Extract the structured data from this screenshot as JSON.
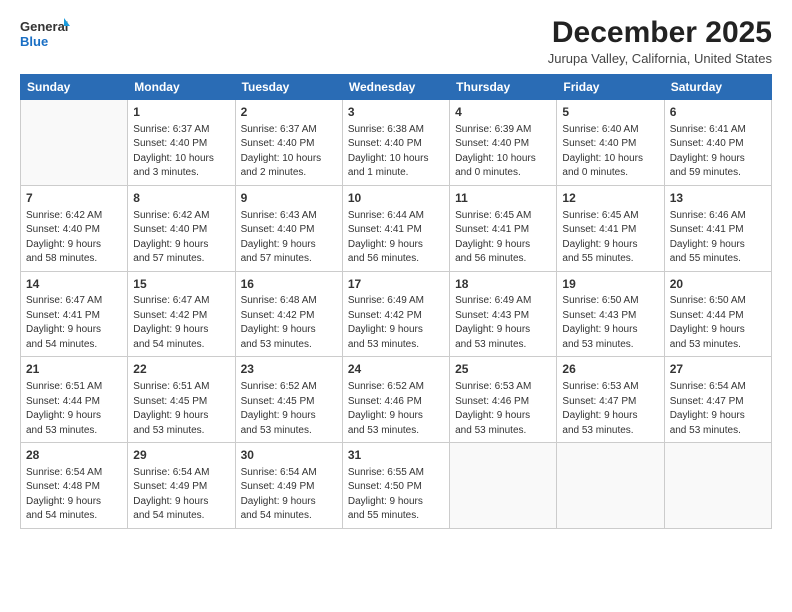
{
  "header": {
    "logo_line1": "General",
    "logo_line2": "Blue",
    "month": "December 2025",
    "location": "Jurupa Valley, California, United States"
  },
  "days_of_week": [
    "Sunday",
    "Monday",
    "Tuesday",
    "Wednesday",
    "Thursday",
    "Friday",
    "Saturday"
  ],
  "weeks": [
    [
      {
        "day": "",
        "info": ""
      },
      {
        "day": "1",
        "info": "Sunrise: 6:37 AM\nSunset: 4:40 PM\nDaylight: 10 hours\nand 3 minutes."
      },
      {
        "day": "2",
        "info": "Sunrise: 6:37 AM\nSunset: 4:40 PM\nDaylight: 10 hours\nand 2 minutes."
      },
      {
        "day": "3",
        "info": "Sunrise: 6:38 AM\nSunset: 4:40 PM\nDaylight: 10 hours\nand 1 minute."
      },
      {
        "day": "4",
        "info": "Sunrise: 6:39 AM\nSunset: 4:40 PM\nDaylight: 10 hours\nand 0 minutes."
      },
      {
        "day": "5",
        "info": "Sunrise: 6:40 AM\nSunset: 4:40 PM\nDaylight: 10 hours\nand 0 minutes."
      },
      {
        "day": "6",
        "info": "Sunrise: 6:41 AM\nSunset: 4:40 PM\nDaylight: 9 hours\nand 59 minutes."
      }
    ],
    [
      {
        "day": "7",
        "info": "Sunrise: 6:42 AM\nSunset: 4:40 PM\nDaylight: 9 hours\nand 58 minutes."
      },
      {
        "day": "8",
        "info": "Sunrise: 6:42 AM\nSunset: 4:40 PM\nDaylight: 9 hours\nand 57 minutes."
      },
      {
        "day": "9",
        "info": "Sunrise: 6:43 AM\nSunset: 4:40 PM\nDaylight: 9 hours\nand 57 minutes."
      },
      {
        "day": "10",
        "info": "Sunrise: 6:44 AM\nSunset: 4:41 PM\nDaylight: 9 hours\nand 56 minutes."
      },
      {
        "day": "11",
        "info": "Sunrise: 6:45 AM\nSunset: 4:41 PM\nDaylight: 9 hours\nand 56 minutes."
      },
      {
        "day": "12",
        "info": "Sunrise: 6:45 AM\nSunset: 4:41 PM\nDaylight: 9 hours\nand 55 minutes."
      },
      {
        "day": "13",
        "info": "Sunrise: 6:46 AM\nSunset: 4:41 PM\nDaylight: 9 hours\nand 55 minutes."
      }
    ],
    [
      {
        "day": "14",
        "info": "Sunrise: 6:47 AM\nSunset: 4:41 PM\nDaylight: 9 hours\nand 54 minutes."
      },
      {
        "day": "15",
        "info": "Sunrise: 6:47 AM\nSunset: 4:42 PM\nDaylight: 9 hours\nand 54 minutes."
      },
      {
        "day": "16",
        "info": "Sunrise: 6:48 AM\nSunset: 4:42 PM\nDaylight: 9 hours\nand 53 minutes."
      },
      {
        "day": "17",
        "info": "Sunrise: 6:49 AM\nSunset: 4:42 PM\nDaylight: 9 hours\nand 53 minutes."
      },
      {
        "day": "18",
        "info": "Sunrise: 6:49 AM\nSunset: 4:43 PM\nDaylight: 9 hours\nand 53 minutes."
      },
      {
        "day": "19",
        "info": "Sunrise: 6:50 AM\nSunset: 4:43 PM\nDaylight: 9 hours\nand 53 minutes."
      },
      {
        "day": "20",
        "info": "Sunrise: 6:50 AM\nSunset: 4:44 PM\nDaylight: 9 hours\nand 53 minutes."
      }
    ],
    [
      {
        "day": "21",
        "info": "Sunrise: 6:51 AM\nSunset: 4:44 PM\nDaylight: 9 hours\nand 53 minutes."
      },
      {
        "day": "22",
        "info": "Sunrise: 6:51 AM\nSunset: 4:45 PM\nDaylight: 9 hours\nand 53 minutes."
      },
      {
        "day": "23",
        "info": "Sunrise: 6:52 AM\nSunset: 4:45 PM\nDaylight: 9 hours\nand 53 minutes."
      },
      {
        "day": "24",
        "info": "Sunrise: 6:52 AM\nSunset: 4:46 PM\nDaylight: 9 hours\nand 53 minutes."
      },
      {
        "day": "25",
        "info": "Sunrise: 6:53 AM\nSunset: 4:46 PM\nDaylight: 9 hours\nand 53 minutes."
      },
      {
        "day": "26",
        "info": "Sunrise: 6:53 AM\nSunset: 4:47 PM\nDaylight: 9 hours\nand 53 minutes."
      },
      {
        "day": "27",
        "info": "Sunrise: 6:54 AM\nSunset: 4:47 PM\nDaylight: 9 hours\nand 53 minutes."
      }
    ],
    [
      {
        "day": "28",
        "info": "Sunrise: 6:54 AM\nSunset: 4:48 PM\nDaylight: 9 hours\nand 54 minutes."
      },
      {
        "day": "29",
        "info": "Sunrise: 6:54 AM\nSunset: 4:49 PM\nDaylight: 9 hours\nand 54 minutes."
      },
      {
        "day": "30",
        "info": "Sunrise: 6:54 AM\nSunset: 4:49 PM\nDaylight: 9 hours\nand 54 minutes."
      },
      {
        "day": "31",
        "info": "Sunrise: 6:55 AM\nSunset: 4:50 PM\nDaylight: 9 hours\nand 55 minutes."
      },
      {
        "day": "",
        "info": ""
      },
      {
        "day": "",
        "info": ""
      },
      {
        "day": "",
        "info": ""
      }
    ]
  ]
}
